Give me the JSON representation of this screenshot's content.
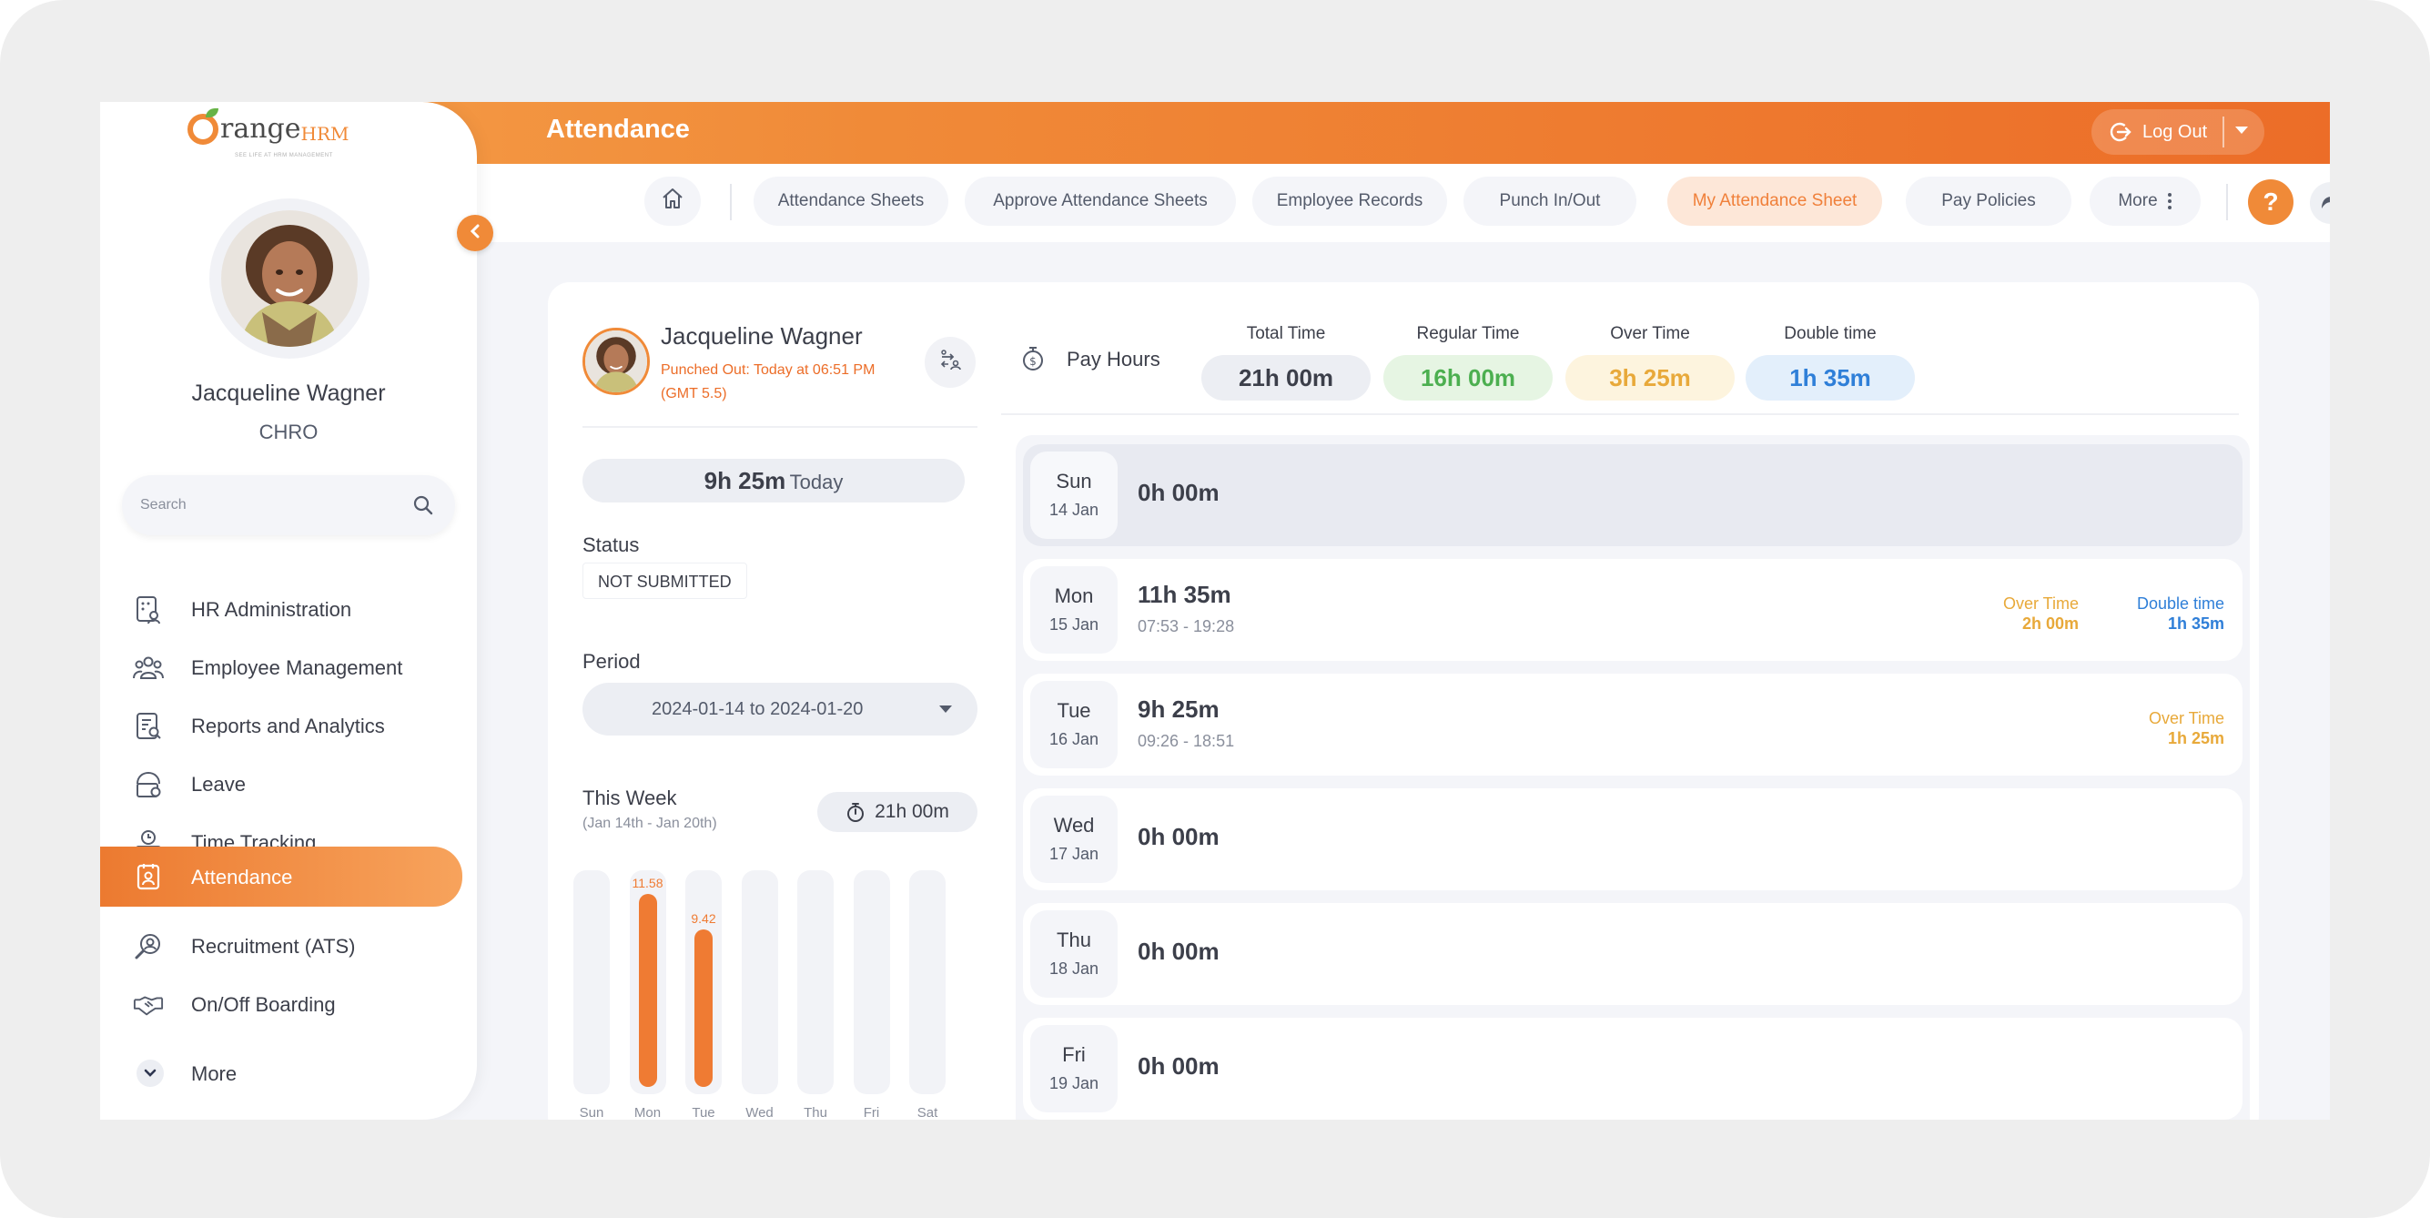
{
  "header": {
    "title": "Attendance",
    "logout_label": "Log Out"
  },
  "logo": {
    "text": "range",
    "suffix": "HRM",
    "tagline": "SEE LIFE AT HRM MANAGEMENT"
  },
  "nav": {
    "items": [
      {
        "label": "Attendance Sheets",
        "active": false
      },
      {
        "label": "Approve Attendance Sheets",
        "active": false
      },
      {
        "label": "Employee Records",
        "active": false
      },
      {
        "label": "Punch In/Out",
        "active": false
      },
      {
        "label": "My Attendance Sheet",
        "active": true
      },
      {
        "label": "Pay Policies",
        "active": false
      },
      {
        "label": "More",
        "active": false
      }
    ],
    "help_label": "?"
  },
  "user": {
    "name": "Jacqueline Wagner",
    "role": "CHRO"
  },
  "search": {
    "placeholder": "Search"
  },
  "sidebar": {
    "items": [
      {
        "label": "HR Administration",
        "icon": "hr-admin-icon",
        "active": false
      },
      {
        "label": "Employee Management",
        "icon": "people-icon",
        "active": false
      },
      {
        "label": "Reports and Analytics",
        "icon": "reports-icon",
        "active": false
      },
      {
        "label": "Leave",
        "icon": "leave-icon",
        "active": false
      },
      {
        "label": "Time Tracking",
        "icon": "time-tracking-icon",
        "active": false
      },
      {
        "label": "Attendance",
        "icon": "attendance-icon",
        "active": true
      },
      {
        "label": "Recruitment (ATS)",
        "icon": "recruitment-icon",
        "active": false
      },
      {
        "label": "On/Off Boarding",
        "icon": "handshake-icon",
        "active": false
      }
    ],
    "more_label": "More"
  },
  "employee": {
    "name": "Jacqueline Wagner",
    "status_line1": "Punched Out: Today at 06:51 PM",
    "status_line2": "(GMT 5.5)"
  },
  "today": {
    "value": "9h 25m",
    "suffix": "Today"
  },
  "status": {
    "label": "Status",
    "value": "NOT SUBMITTED"
  },
  "period": {
    "label": "Period",
    "value": "2024-01-14 to 2024-01-20"
  },
  "this_week": {
    "title": "This Week",
    "range": "(Jan 14th - Jan 20th)",
    "total": "21h 00m"
  },
  "chart_data": {
    "type": "bar",
    "categories": [
      "Sun",
      "Mon",
      "Tue",
      "Wed",
      "Thu",
      "Fri",
      "Sat"
    ],
    "values": [
      0,
      11.58,
      9.42,
      0,
      0,
      0,
      0
    ],
    "value_labels": [
      "",
      "11.58",
      "9.42",
      "",
      "",
      "",
      ""
    ],
    "ylim": [
      0,
      12
    ],
    "color": "#ef7b33"
  },
  "pay_hours": {
    "label": "Pay Hours",
    "columns": [
      {
        "label": "Total Time",
        "value": "21h 00m",
        "bg": "#eceef3",
        "color": "#3c3f4a"
      },
      {
        "label": "Regular Time",
        "value": "16h 00m",
        "bg": "#e6f5e3",
        "color": "#4caf50"
      },
      {
        "label": "Over Time",
        "value": "3h 25m",
        "bg": "#fdf4de",
        "color": "#e8a93a"
      },
      {
        "label": "Double time",
        "value": "1h 35m",
        "bg": "#e3effb",
        "color": "#2f7fd8"
      }
    ]
  },
  "days": [
    {
      "name": "Sun",
      "date": "14 Jan",
      "total": "0h 00m",
      "span": "",
      "overtime": null,
      "double": null,
      "shaded": true
    },
    {
      "name": "Mon",
      "date": "15 Jan",
      "total": "11h 35m",
      "span": "07:53 - 19:28",
      "overtime": {
        "label": "Over Time",
        "value": "2h 00m"
      },
      "double": {
        "label": "Double time",
        "value": "1h 35m"
      },
      "shaded": false
    },
    {
      "name": "Tue",
      "date": "16 Jan",
      "total": "9h 25m",
      "span": "09:26 - 18:51",
      "overtime": {
        "label": "Over Time",
        "value": "1h 25m"
      },
      "double": null,
      "shaded": false
    },
    {
      "name": "Wed",
      "date": "17 Jan",
      "total": "0h 00m",
      "span": "",
      "overtime": null,
      "double": null,
      "shaded": false
    },
    {
      "name": "Thu",
      "date": "18 Jan",
      "total": "0h 00m",
      "span": "",
      "overtime": null,
      "double": null,
      "shaded": false
    },
    {
      "name": "Fri",
      "date": "19 Jan",
      "total": "0h 00m",
      "span": "",
      "overtime": null,
      "double": null,
      "shaded": false
    }
  ],
  "colors": {
    "accent": "#f08a38",
    "overtime": "#e8a93a",
    "double": "#2f7fd8"
  }
}
